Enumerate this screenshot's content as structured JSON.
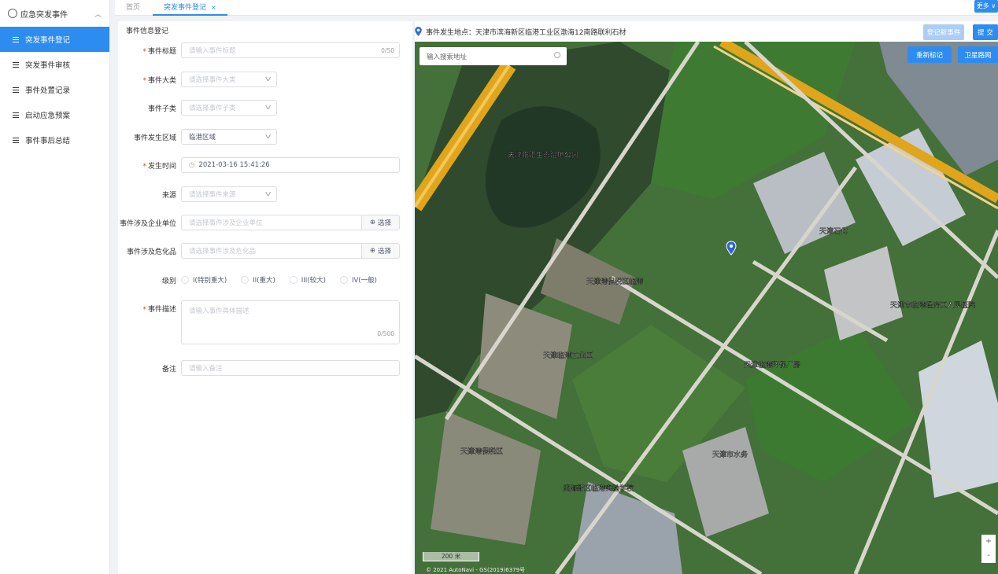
{
  "sidebar": {
    "title": "应急突发事件",
    "items": [
      {
        "label": "突发事件登记",
        "active": true
      },
      {
        "label": "突发事件审核"
      },
      {
        "label": "事件处置记录"
      },
      {
        "label": "启动应急预案"
      },
      {
        "label": "事件事后总结"
      }
    ]
  },
  "tabs": [
    {
      "label": "首页"
    },
    {
      "label": "突发事件登记",
      "close": "×",
      "active": true
    }
  ],
  "more_label": "更多",
  "form": {
    "title": "事件信息登记",
    "title_field": {
      "label": "事件标题",
      "placeholder": "请输入事件标题",
      "count": "0/50"
    },
    "category": {
      "label": "事件大类",
      "placeholder": "请选择事件大类"
    },
    "subcategory": {
      "label": "事件子类",
      "placeholder": "请选择事件子类"
    },
    "area": {
      "label": "事件发生区域",
      "value": "临港区域"
    },
    "time": {
      "label": "发生时间",
      "value": "2021-03-16 15:41:26"
    },
    "source": {
      "label": "来源",
      "placeholder": "请选择事件来源"
    },
    "company": {
      "label": "事件涉及企业单位",
      "placeholder": "请选择事件涉及企业单位",
      "button": "选择"
    },
    "chemical": {
      "label": "事件涉及危化品",
      "placeholder": "请选择事件涉及危化品",
      "button": "选择"
    },
    "level": {
      "label": "级别",
      "options": [
        "I(特别重大)",
        "II(重大)",
        "III(较大)",
        "IV(一般)"
      ]
    },
    "description": {
      "label": "事件描述",
      "placeholder": "请输入事件具体描述",
      "count": "0/500"
    },
    "remark": {
      "label": "备注",
      "placeholder": "请输入备注"
    }
  },
  "map": {
    "location_label": "事件发生地点：",
    "location": "天津市滨海新区临港工业区渤海12南路联利石材",
    "register_button": "登记新事件",
    "submit_button": "提 交",
    "search_placeholder": "输入搜索地址",
    "remark_button": "重新标记",
    "satellite_button": "卫星路网",
    "scale": "200 米",
    "copyright": "© 2021 AutoNavi - GS(2019)6379号",
    "zoom_in": "+",
    "zoom_out": "-",
    "labels": [
      "天津临港生态湿地公园",
      "天津港保税区临港",
      "天津临港工业区",
      "天津石化",
      "天津市临港经济区人民医院",
      "天津港保税区",
      "天津临港环保厂房",
      "天津市水务",
      "滨海新区临港实验学校"
    ]
  },
  "colors": {
    "primary": "#2d8cf0",
    "disabled": "#abcdf7",
    "required": "#ed4014"
  }
}
